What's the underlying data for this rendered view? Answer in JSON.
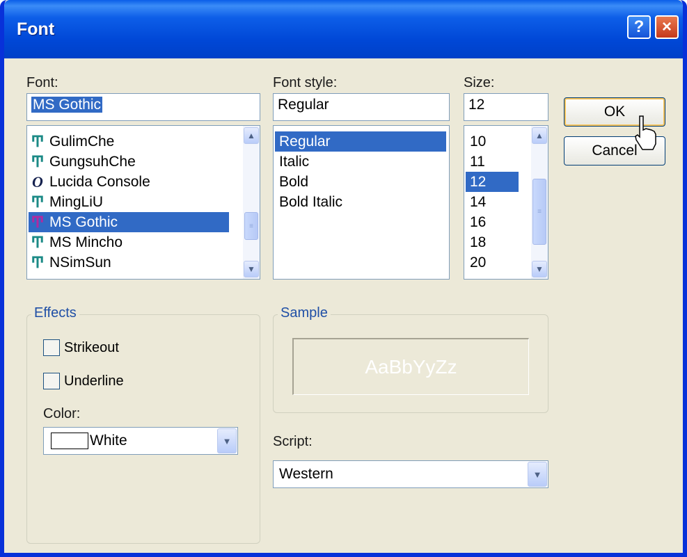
{
  "window": {
    "title": "Font",
    "help_label": "?",
    "close_label": "×"
  },
  "font": {
    "label": "Font:",
    "value": "MS Gothic",
    "items": [
      {
        "name": "GulimChe",
        "icon": "truetype-icon"
      },
      {
        "name": "GungsuhChe",
        "icon": "truetype-icon"
      },
      {
        "name": "Lucida Console",
        "icon": "opentype-icon"
      },
      {
        "name": "MingLiU",
        "icon": "truetype-icon"
      },
      {
        "name": "MS Gothic",
        "icon": "truetype-icon",
        "selected": true
      },
      {
        "name": "MS Mincho",
        "icon": "truetype-icon"
      },
      {
        "name": "NSimSun",
        "icon": "truetype-icon"
      }
    ]
  },
  "style": {
    "label": "Font style:",
    "value": "Regular",
    "items": [
      {
        "name": "Regular",
        "selected": true
      },
      {
        "name": "Italic"
      },
      {
        "name": "Bold"
      },
      {
        "name": "Bold Italic"
      }
    ]
  },
  "size": {
    "label": "Size:",
    "value": "12",
    "items": [
      {
        "name": "10"
      },
      {
        "name": "11"
      },
      {
        "name": "12",
        "selected": true
      },
      {
        "name": "14"
      },
      {
        "name": "16"
      },
      {
        "name": "18"
      },
      {
        "name": "20"
      }
    ]
  },
  "buttons": {
    "ok": "OK",
    "cancel": "Cancel"
  },
  "effects": {
    "title": "Effects",
    "strikeout": "Strikeout",
    "underline": "Underline",
    "color_label": "Color:",
    "color_value": "White"
  },
  "sample": {
    "title": "Sample",
    "text": "AaBbYyZz"
  },
  "script": {
    "label": "Script:",
    "value": "Western"
  },
  "icons": {
    "truetype": "Ͳ",
    "opentype": "O",
    "scroll_up": "▲",
    "scroll_down": "▼",
    "grip": "≡",
    "dropdown": "▼"
  },
  "colors": {
    "titlebar": "#0a5ee8",
    "selection": "#316ac5",
    "dialog_bg": "#ece9d8"
  }
}
